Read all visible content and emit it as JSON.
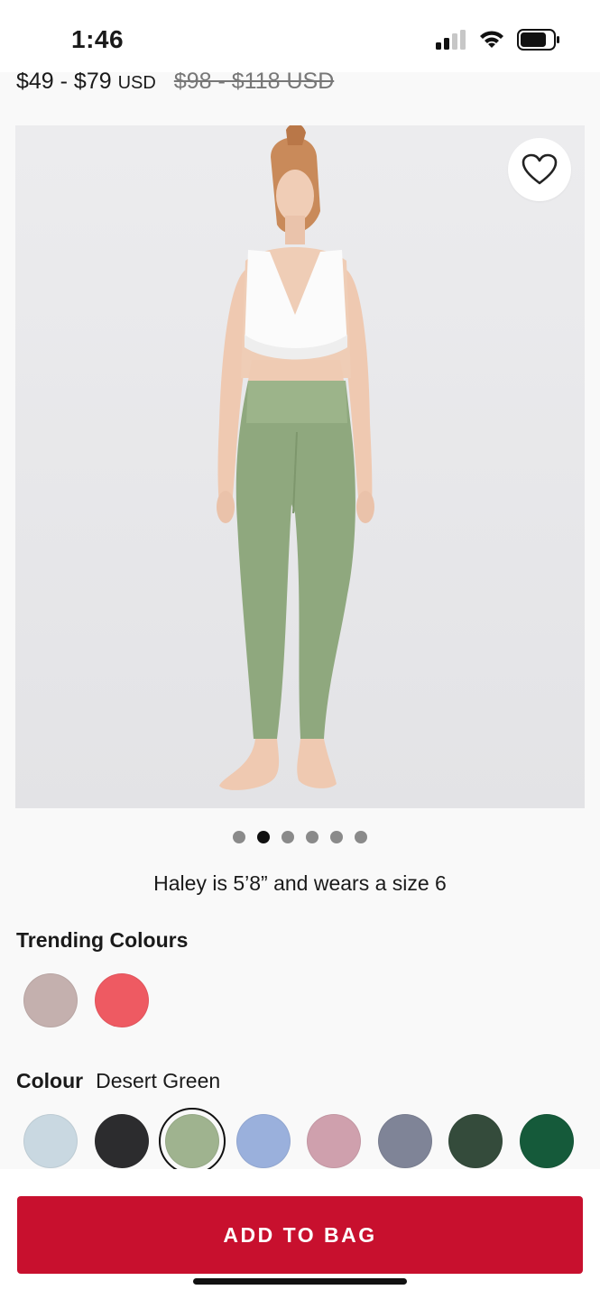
{
  "status_bar": {
    "time": "1:46",
    "signal_icon": "cellular-signal-icon",
    "wifi_icon": "wifi-icon",
    "battery_icon": "battery-icon"
  },
  "product": {
    "price_range": "$49 - $79",
    "price_unit": "USD",
    "original_price": "$98 - $118 USD",
    "favorite_icon": "heart-icon",
    "image_count": 6,
    "active_image_index": 1,
    "model_caption": "Haley is 5’8” and wears a size 6"
  },
  "trending": {
    "title": "Trending Colours",
    "swatches": [
      {
        "name": "pink-beige",
        "color": "#c4b0ae"
      },
      {
        "name": "coral-red",
        "color": "#ee5a62"
      }
    ]
  },
  "colour": {
    "label": "Colour",
    "selected_name": "Desert Green",
    "swatches": [
      {
        "name": "light-blue",
        "color": "#c9d8e1"
      },
      {
        "name": "black",
        "color": "#2c2c2e"
      },
      {
        "name": "desert-green",
        "color": "#9fb38f",
        "selected": true
      },
      {
        "name": "periwinkle",
        "color": "#9ab0dc"
      },
      {
        "name": "mauve-pink",
        "color": "#cfa0ad"
      },
      {
        "name": "slate",
        "color": "#7f8497"
      },
      {
        "name": "dark-green",
        "color": "#344b3b"
      },
      {
        "name": "emerald",
        "color": "#155a3a"
      }
    ]
  },
  "cta": {
    "label": "ADD TO BAG",
    "color": "#c8102e"
  }
}
